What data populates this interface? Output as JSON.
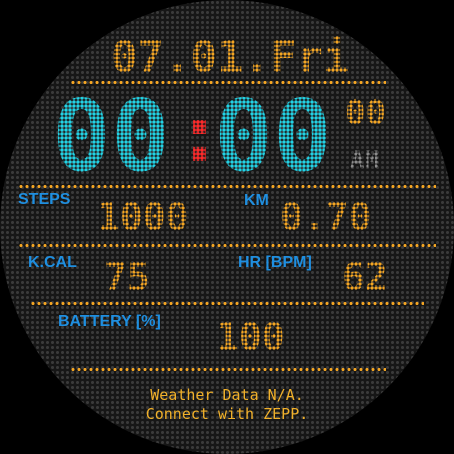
{
  "date": "07.01.Fri",
  "time": {
    "hours": "00",
    "colon": ":",
    "minutes": "00",
    "seconds": "00",
    "ampm": "AM"
  },
  "steps": {
    "label": "STEPS",
    "value": "1000"
  },
  "km": {
    "label": "KM",
    "value": "0.70"
  },
  "kcal": {
    "label": "K.CAL",
    "value": "75"
  },
  "hr": {
    "label": "HR [BPM]",
    "value": "62"
  },
  "battery": {
    "label": "BATTERY [%]",
    "value": "100"
  },
  "weather": {
    "line1": "Weather Data N/A.",
    "line2": "Connect with ZEPP."
  },
  "colors": {
    "accent": "#f5a623",
    "time": "#22d3e6",
    "label": "#1f8fe0",
    "colon": "#ff2a2a",
    "ampm": "#8c8c8c"
  }
}
